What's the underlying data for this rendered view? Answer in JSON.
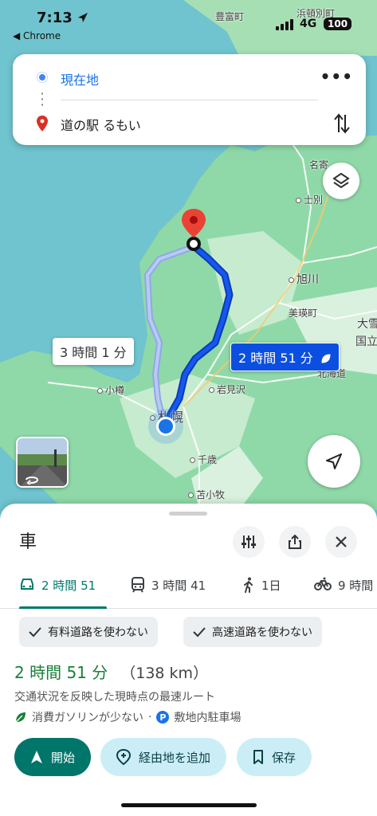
{
  "status_bar": {
    "time": "7:13",
    "back_app": "◀ Chrome",
    "network": "4G",
    "battery": "100"
  },
  "search": {
    "origin": "現在地",
    "destination": "道の駅 るもい"
  },
  "map": {
    "labels": [
      "豊富町",
      "浜頓別町",
      "名寄",
      "士別",
      "旭川",
      "美瑛町",
      "大雪",
      "国立",
      "北海道",
      "岩見沢",
      "小樽",
      "札幌",
      "千歳",
      "苫小牧"
    ],
    "route_alt_label": "3 時間 1 分",
    "route_main_label": "2 時間 51 分"
  },
  "sheet": {
    "title": "車",
    "modes": [
      {
        "icon": "car-icon",
        "label": "2 時間 51"
      },
      {
        "icon": "train-icon",
        "label": "3 時間 41"
      },
      {
        "icon": "walk-icon",
        "label": "1日"
      },
      {
        "icon": "bike-icon",
        "label": "9 時間"
      }
    ],
    "chips": [
      "有料道路を使わない",
      "高速道路を使わない"
    ],
    "duration": "2 時間 51 分",
    "distance": "（138 km）",
    "subtext": "交通状況を反映した現時点の最速ルート",
    "eco_text": "消費ガソリンが少ない",
    "separator": "·",
    "parking_text": "敷地内駐車場",
    "parking_letter": "P",
    "actions": {
      "start": "開始",
      "add_stop": "経由地を追加",
      "save": "保存"
    }
  },
  "colors": {
    "accent": "#00766b",
    "route": "#0b4fe0",
    "sea": "#6fc4cf",
    "land": "#8fd9a8"
  }
}
